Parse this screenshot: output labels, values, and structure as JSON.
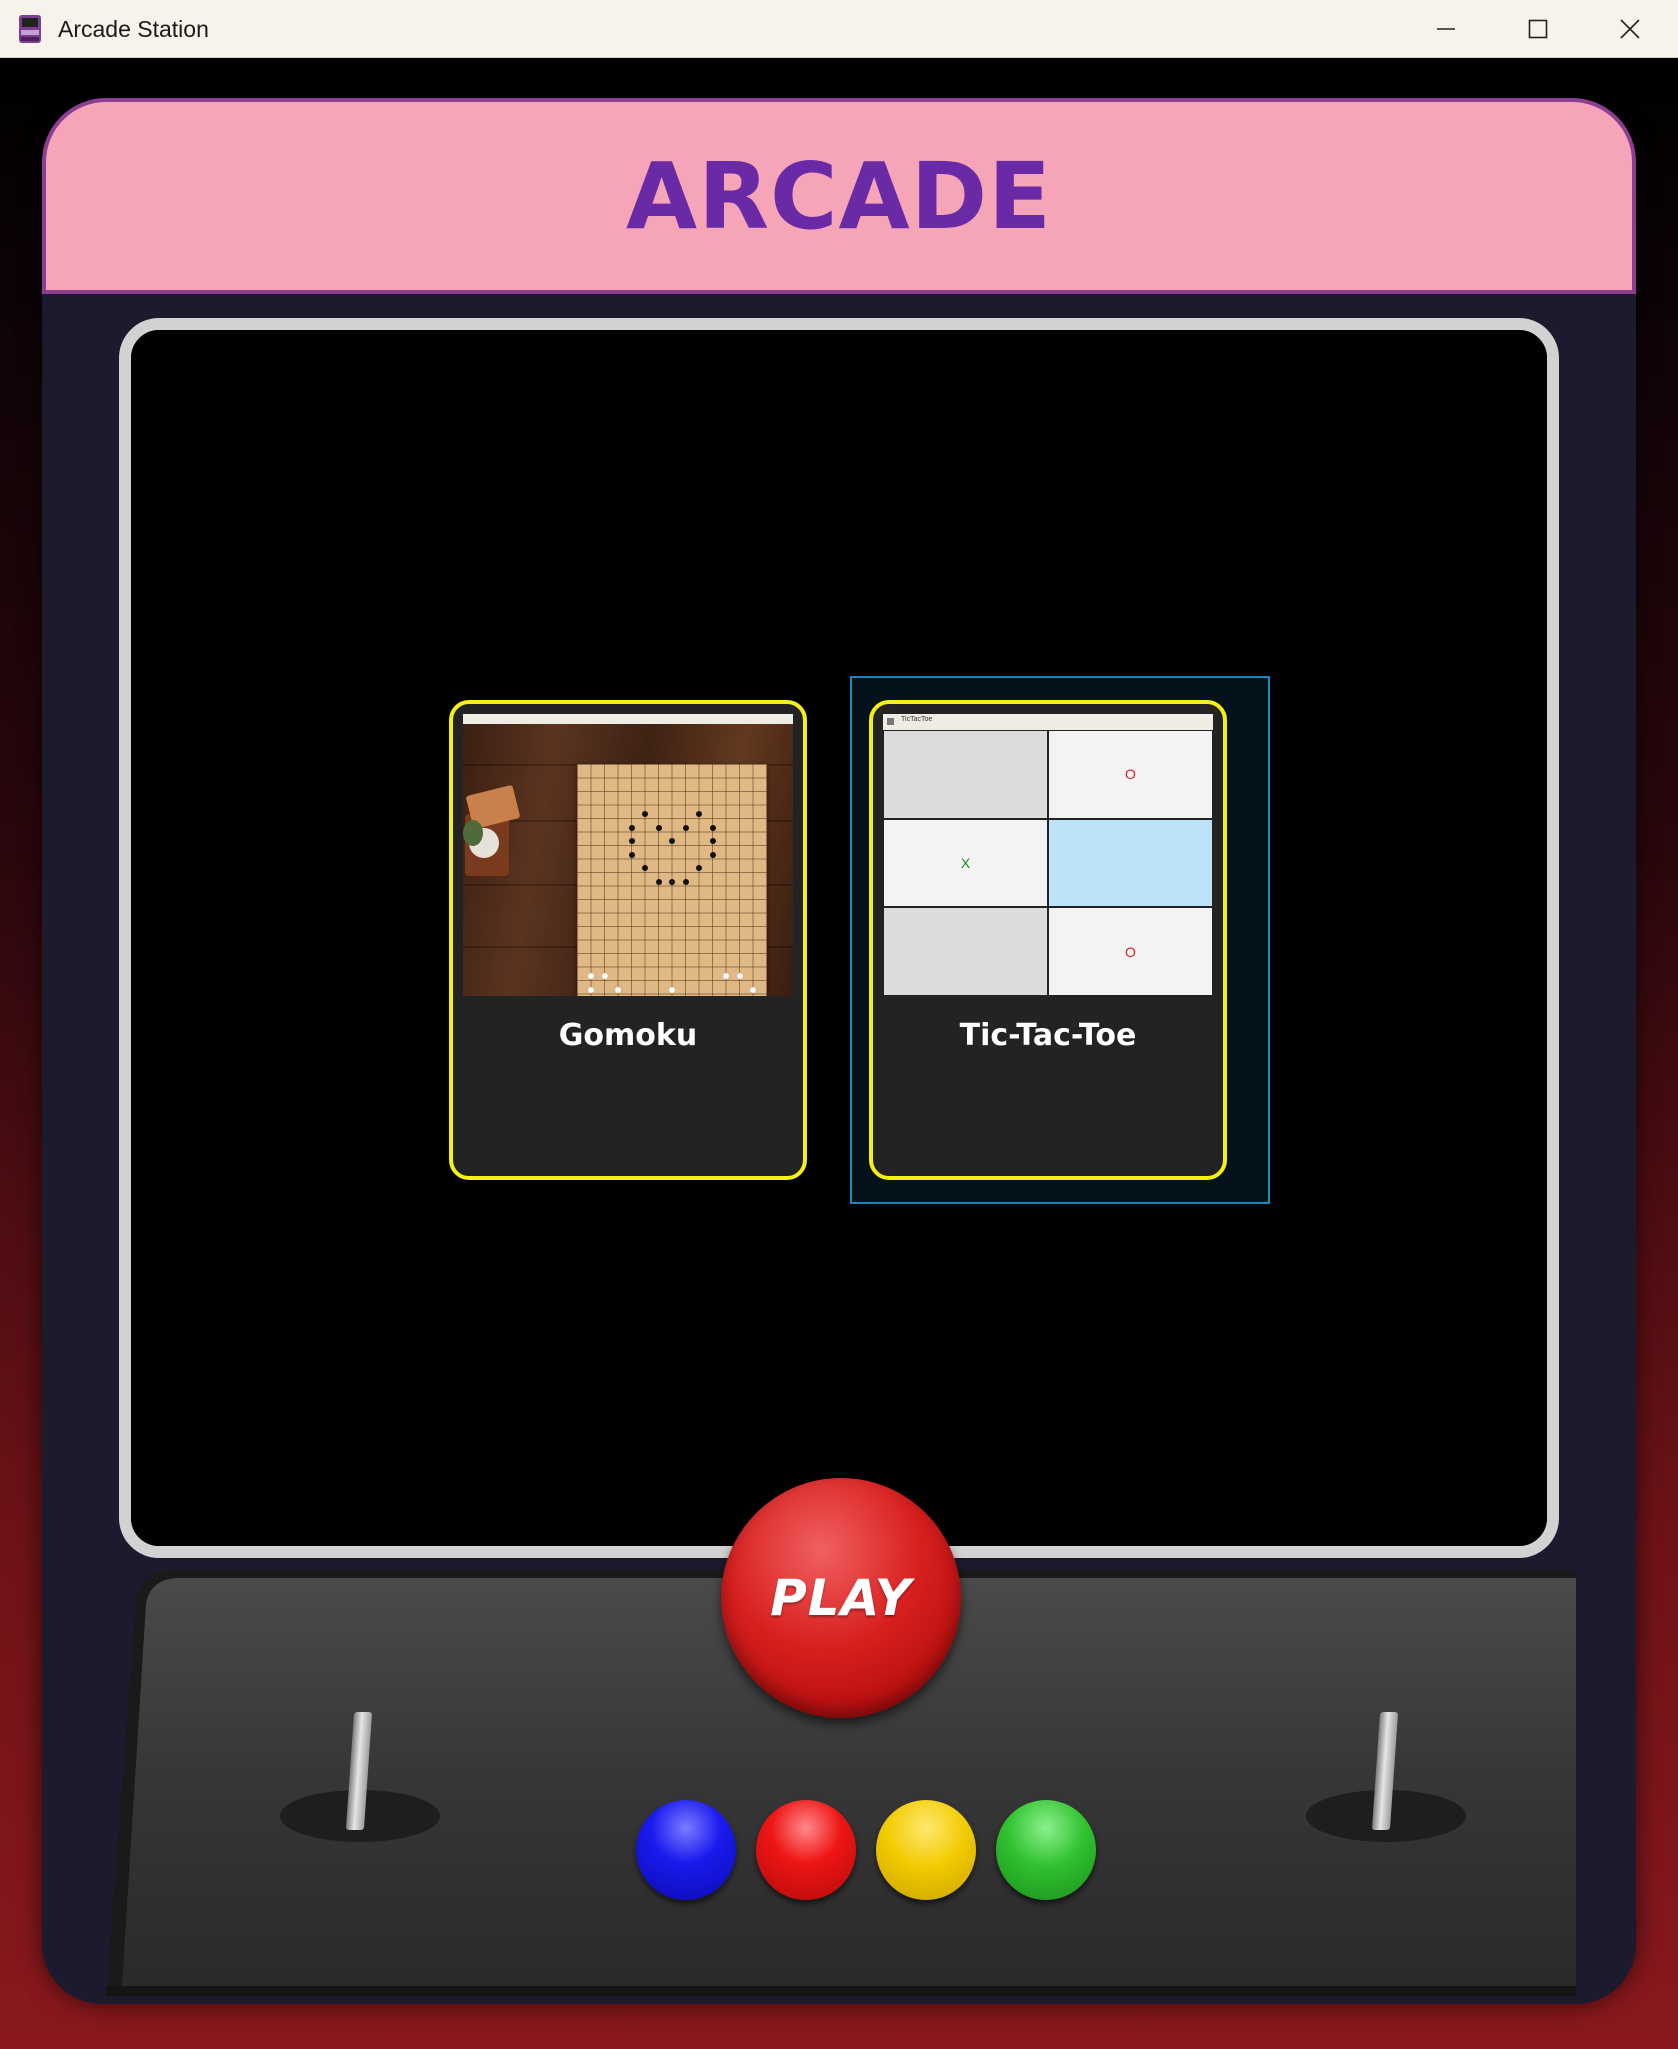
{
  "window": {
    "title": "Arcade Station",
    "controls": [
      "minimize",
      "maximize",
      "close"
    ]
  },
  "marquee": {
    "title": "ARCADE"
  },
  "games": [
    {
      "label": "Gomoku",
      "thumbnail": "gomoku-board-screenshot",
      "selected": false
    },
    {
      "label": "Tic-Tac-Toe",
      "thumbnail": "tic-tac-toe-screenshot",
      "selected": true
    }
  ],
  "tictactoe_preview": {
    "titlebar_text": "TicTacToe",
    "cells": [
      "",
      "O",
      "X",
      "",
      "",
      "O"
    ],
    "x_color": "#1d8a1d",
    "o_color": "#d4211e",
    "highlight_color": "#bde3fb"
  },
  "controls": {
    "play_label": "PLAY",
    "button_colors": [
      "#1515ee",
      "#ee1515",
      "#f2cb00",
      "#2fc12f"
    ]
  },
  "colors": {
    "marquee_bg": "#f6a5b8",
    "marquee_text": "#6b2aa5",
    "card_border": "#f5f016",
    "focus_border": "#1e86bf"
  }
}
